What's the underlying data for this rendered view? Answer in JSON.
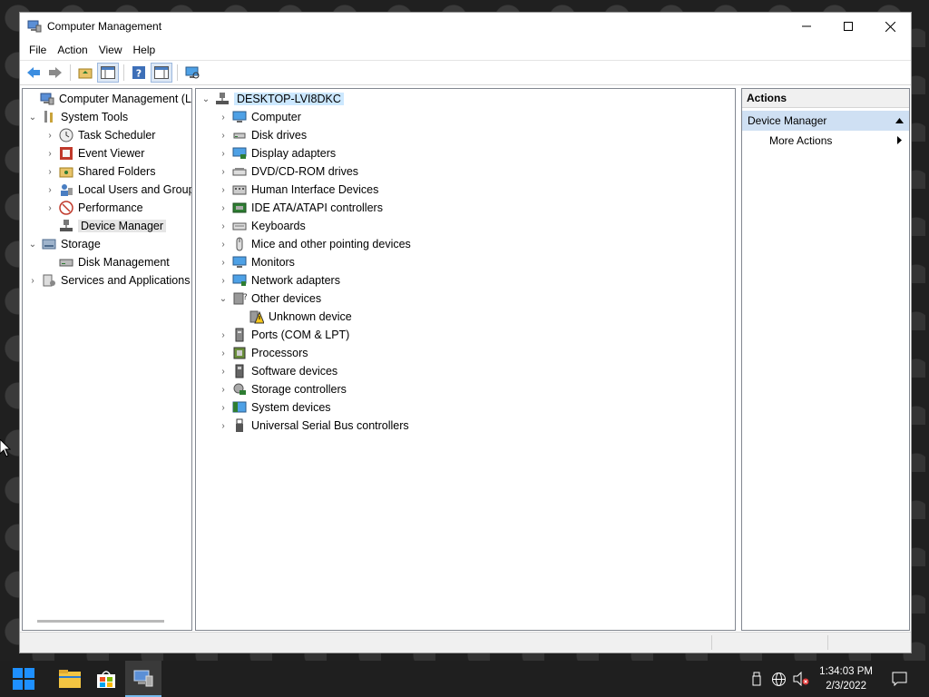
{
  "window": {
    "title": "Computer Management"
  },
  "menu": [
    "File",
    "Action",
    "View",
    "Help"
  ],
  "left_tree": {
    "root": "Computer Management (Local)",
    "system_tools": "System Tools",
    "task_scheduler": "Task Scheduler",
    "event_viewer": "Event Viewer",
    "shared_folders": "Shared Folders",
    "local_users": "Local Users and Groups",
    "performance": "Performance",
    "device_manager": "Device Manager",
    "storage": "Storage",
    "disk_management": "Disk Management",
    "services": "Services and Applications"
  },
  "device_tree": {
    "root": "DESKTOP-LVI8DKC",
    "categories": [
      "Computer",
      "Disk drives",
      "Display adapters",
      "DVD/CD-ROM drives",
      "Human Interface Devices",
      "IDE ATA/ATAPI controllers",
      "Keyboards",
      "Mice and other pointing devices",
      "Monitors",
      "Network adapters",
      "Other devices",
      "Ports (COM & LPT)",
      "Processors",
      "Software devices",
      "Storage controllers",
      "System devices",
      "Universal Serial Bus controllers"
    ],
    "other_devices_child": "Unknown device"
  },
  "actions": {
    "header": "Actions",
    "group": "Device Manager",
    "more": "More Actions"
  },
  "taskbar": {
    "time": "1:34:03 PM",
    "date": "2/3/2022"
  }
}
